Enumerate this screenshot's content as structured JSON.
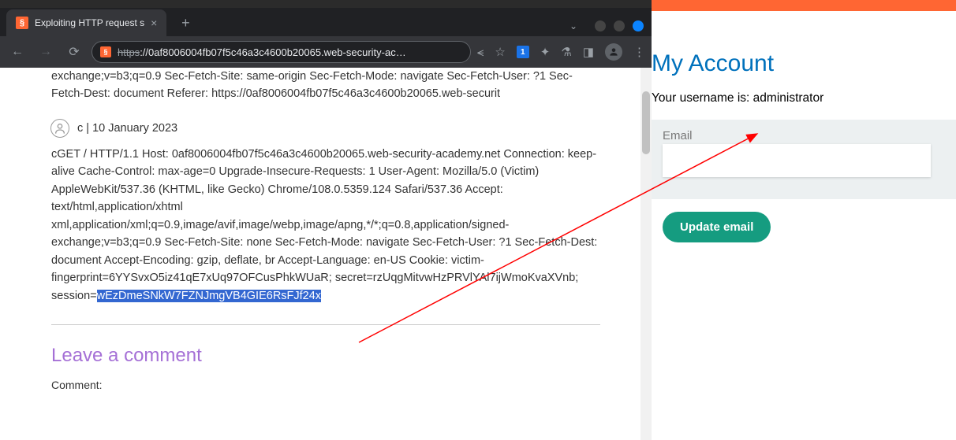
{
  "browser": {
    "tab_title": "Exploiting HTTP request s",
    "url_https": "https",
    "url_display": "://0af8006004fb07f5c46a3c4600b20065.web-security-ac…"
  },
  "page": {
    "partial_comment_top": "exchange;v=b3;q=0.9 Sec-Fetch-Site: same-origin Sec-Fetch-Mode: navigate Sec-Fetch-User: ?1 Sec-Fetch-Dest: document Referer: https://0af8006004fb07f5c46a3c4600b20065.web-securit",
    "comment_meta": "c | 10 January 2023",
    "comment_body_pre": "cGET / HTTP/1.1 Host: 0af8006004fb07f5c46a3c4600b20065.web-security-academy.net Connection: keep-alive Cache-Control: max-age=0 Upgrade-Insecure-Requests: 1 User-Agent: Mozilla/5.0 (Victim) AppleWebKit/537.36 (KHTML, like Gecko) Chrome/108.0.5359.124 Safari/537.36 Accept: text/html,application/xhtml xml,application/xml;q=0.9,image/avif,image/webp,image/apng,*/*;q=0.8,application/signed-exchange;v=b3;q=0.9 Sec-Fetch-Site: none Sec-Fetch-Mode: navigate Sec-Fetch-User: ?1 Sec-Fetch-Dest: document Accept-Encoding: gzip, deflate, br Accept-Language: en-US Cookie: victim-fingerprint=6YYSvxO5iz41qE7xUq97OFCusPhkWUaR; secret=rzUqgMitvwHzPRVlYAl7ijWmoKvaXVnb; session=",
    "comment_body_highlight": "wEzDmeSNkW7FZNJmgVB4GIE6RsFJf24x",
    "leave_comment_heading": "Leave a comment",
    "comment_label": "Comment:"
  },
  "account": {
    "title": "My Account",
    "username_line": "Your username is: administrator",
    "email_label": "Email",
    "update_button": "Update email"
  }
}
